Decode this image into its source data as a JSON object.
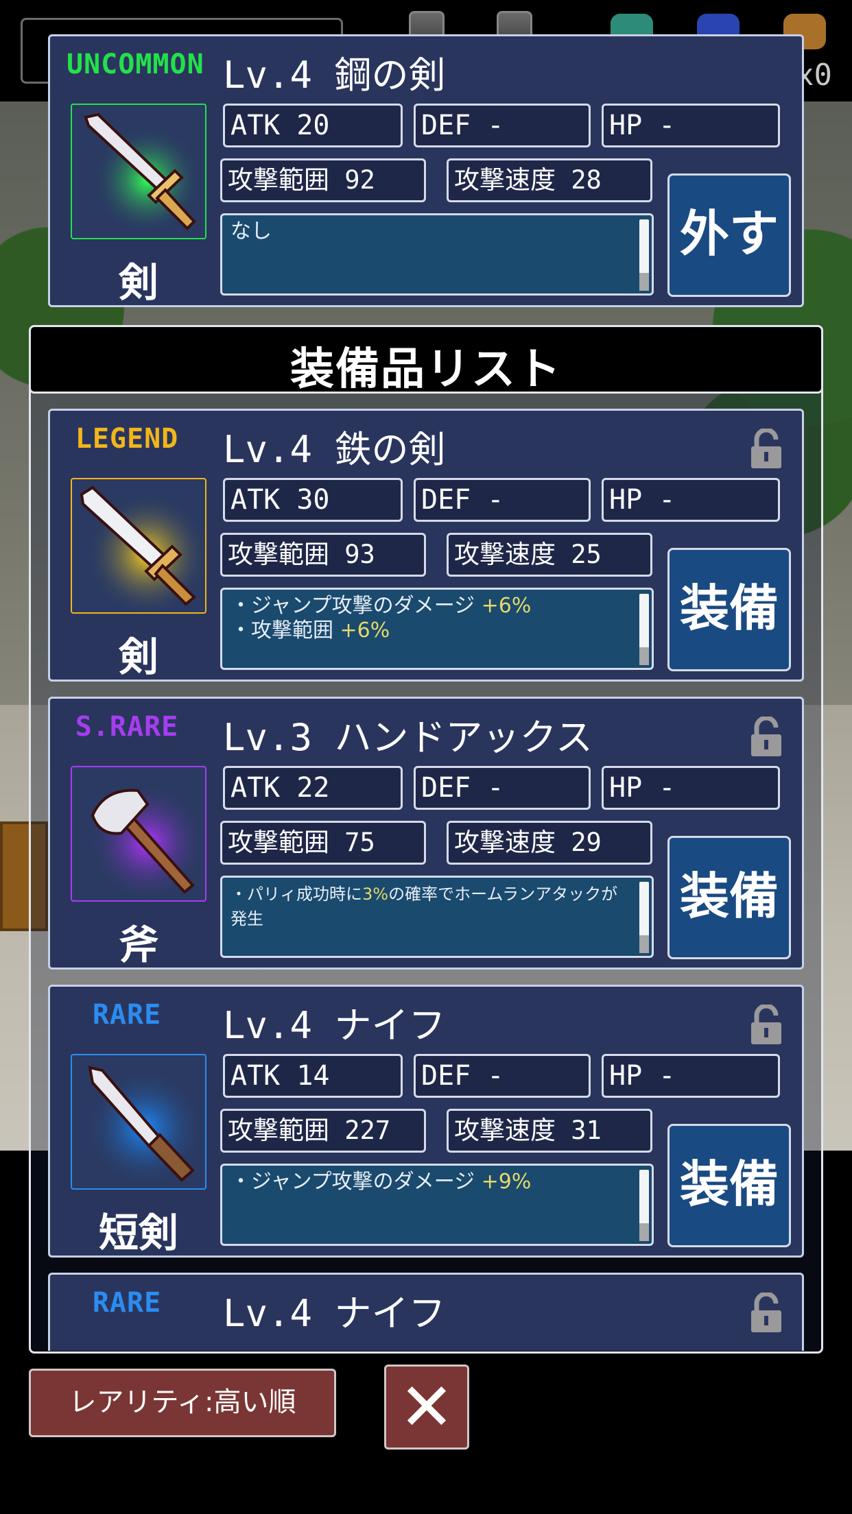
{
  "top_hud": {
    "multiplier_text": "x0"
  },
  "equipped": {
    "rarity": "UNCOMMON",
    "rarity_color": "#22e14a",
    "name": "Lv.4 鋼の剣",
    "type": "剣",
    "icon": "sword-icon",
    "atk": "ATK 20",
    "def": "DEF -",
    "hp": "HP  -",
    "range": "攻撃範囲 92",
    "speed": "攻撃速度 28",
    "desc_lines": [
      "なし"
    ],
    "action": "外す"
  },
  "list_title": "装備品リスト",
  "items": [
    {
      "rarity": "LEGEND",
      "rarity_color": "#f2b619",
      "name": "Lv.4 鉄の剣",
      "type": "剣",
      "icon": "sword-icon",
      "atk": "ATK 30",
      "def": "DEF -",
      "hp": "HP  -",
      "range": "攻撃範囲 93",
      "speed": "攻撃速度 25",
      "desc_1_text": "・ジャンプ攻撃のダメージ",
      "desc_1_bonus": "+6%",
      "desc_2_text": "・攻撃範囲",
      "desc_2_bonus": "+6%",
      "action": "装備"
    },
    {
      "rarity": "S.RARE",
      "rarity_color": "#a63df0",
      "name": "Lv.3 ハンドアックス",
      "type": "斧",
      "icon": "axe-icon",
      "atk": "ATK 22",
      "def": "DEF -",
      "hp": "HP  -",
      "range": "攻撃範囲 75",
      "speed": "攻撃速度 29",
      "desc_1_pre": "・パリィ成功時に",
      "desc_1_bonus": "3%",
      "desc_1_post": "の確率でホームランアタックが発生",
      "action": "装備"
    },
    {
      "rarity": "RARE",
      "rarity_color": "#2a8df2",
      "name": "Lv.4 ナイフ",
      "type": "短剣",
      "icon": "knife-icon",
      "atk": "ATK 14",
      "def": "DEF -",
      "hp": "HP  -",
      "range": "攻撃範囲 227",
      "speed": "攻撃速度 31",
      "desc_1_text": "・ジャンプ攻撃のダメージ",
      "desc_1_bonus": "+9%",
      "action": "装備"
    },
    {
      "rarity": "RARE",
      "rarity_color": "#2a8df2",
      "name": "Lv.4 ナイフ"
    }
  ],
  "sort_button": "レアリティ:高い順",
  "close_button": "✕"
}
